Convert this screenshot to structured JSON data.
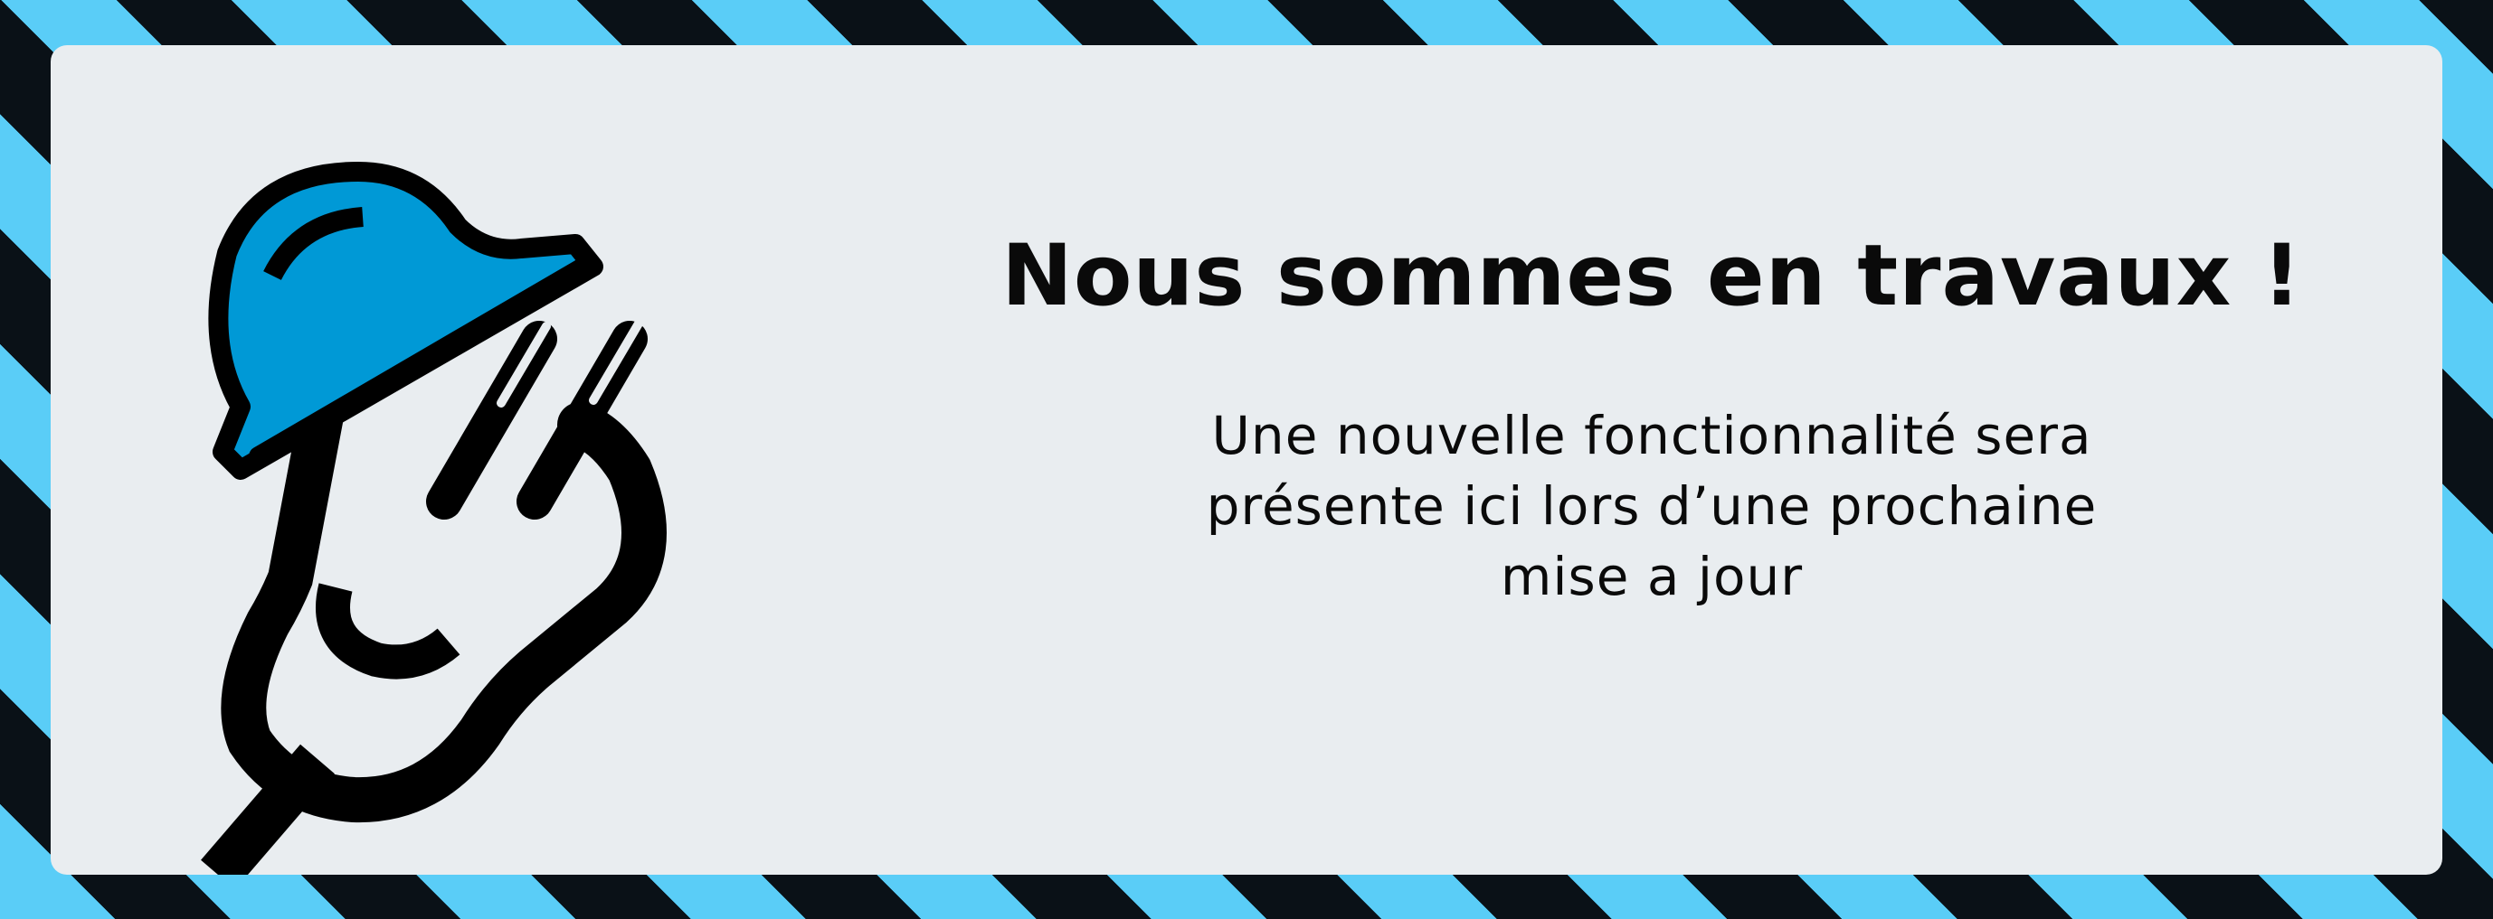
{
  "notice": {
    "title": "Nous sommes en travaux !",
    "message": "Une nouvelle fonctionnalité sera présente ici lors d’une prochaine mise a jour"
  },
  "mascot": {
    "icon": "hardhat-plug-mascot-icon",
    "helmet_color": "#0099d6"
  },
  "colors": {
    "stripe_light": "#5acdf7",
    "stripe_dark": "#0a1117",
    "panel_background": "#e9edf0",
    "text": "#0a0a0a"
  }
}
